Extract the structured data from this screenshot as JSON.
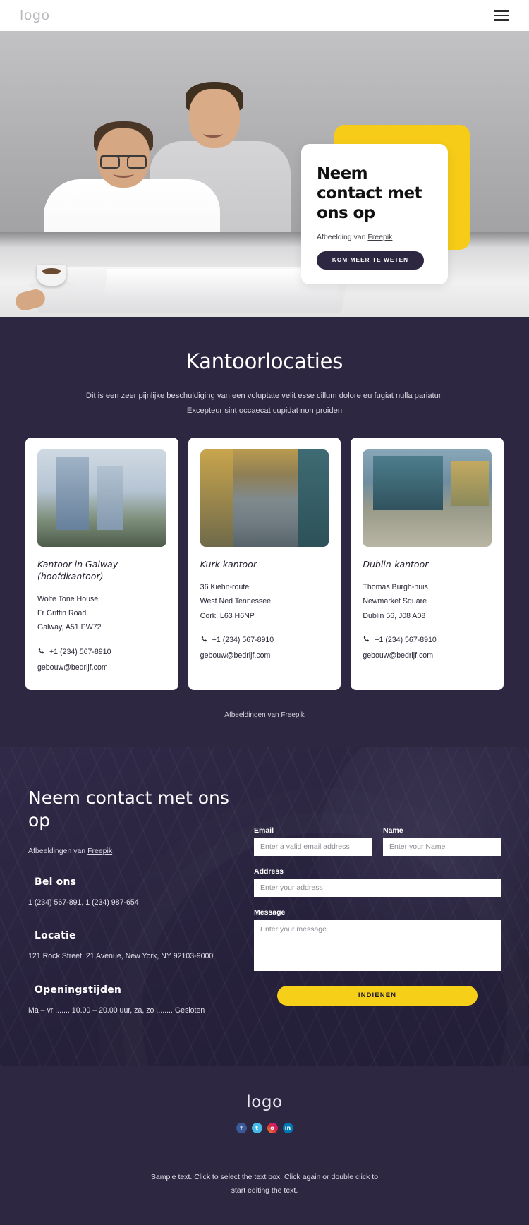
{
  "header": {
    "logo": "logo",
    "menu_icon": "hamburger-menu-icon"
  },
  "hero": {
    "title": "Neem contact met ons op",
    "credit_prefix": "Afbeelding van ",
    "credit_link": "Freepik",
    "button": "KOM MEER TE WETEN",
    "accent_color": "#f6cc18",
    "button_color": "#2d2741"
  },
  "locations": {
    "title": "Kantoorlocaties",
    "description_line1": "Dit is een zeer pijnlijke beschuldiging van een voluptate velit esse cillum dolore eu fugiat nulla pariatur.",
    "description_line2": "Excepteur sint occaecat cupidat non proiden",
    "credit_prefix": "Afbeeldingen van ",
    "credit_link": "Freepik",
    "cards": [
      {
        "title": "Kantoor in Galway (hoofdkantoor)",
        "address": [
          "Wolfe Tone House",
          "Fr Griffin Road",
          "Galway, A51 PW72"
        ],
        "phone": "+1 (234) 567-8910",
        "email": "gebouw@bedrijf.com"
      },
      {
        "title": "Kurk kantoor",
        "address": [
          "36 Kiehn-route",
          "West Ned Tennessee",
          "Cork, L63 H6NP"
        ],
        "phone": "+1 (234) 567-8910",
        "email": "gebouw@bedrijf.com"
      },
      {
        "title": "Dublin-kantoor",
        "address": [
          "Thomas Burgh-huis",
          "Newmarket Square",
          "Dublin 56, J08 A08"
        ],
        "phone": "+1 (234) 567-8910",
        "email": "gebouw@bedrijf.com"
      }
    ]
  },
  "contact": {
    "heading": "Neem contact met ons op",
    "credit_prefix": "Afbeeldingen van ",
    "credit_link": "Freepik",
    "call_title": "Bel ons",
    "call_text": "1 (234) 567-891, 1 (234) 987-654",
    "location_title": "Locatie",
    "location_text": "121 Rock Street, 21 Avenue, New York, NY 92103-9000",
    "hours_title": "Openingstijden",
    "hours_text": "Ma – vr ....... 10.00 – 20.00 uur, za, zo ........ Gesloten",
    "form": {
      "email_label": "Email",
      "email_placeholder": "Enter a valid email address",
      "email_value": "",
      "name_label": "Name",
      "name_placeholder": "Enter your Name",
      "name_value": "",
      "address_label": "Address",
      "address_placeholder": "Enter your address",
      "address_value": "",
      "message_label": "Message",
      "message_placeholder": "Enter your message",
      "message_value": "",
      "submit_label": "INDIENEN",
      "submit_color": "#f6d018"
    }
  },
  "footer": {
    "logo": "logo",
    "socials": [
      "facebook-icon",
      "twitter-icon",
      "instagram-icon",
      "linkedin-icon"
    ],
    "social_glyphs": [
      "f",
      "t",
      "o",
      "in"
    ],
    "text_line1": "Sample text. Click to select the text box. Click again or double click to",
    "text_line2": "start editing the text."
  }
}
